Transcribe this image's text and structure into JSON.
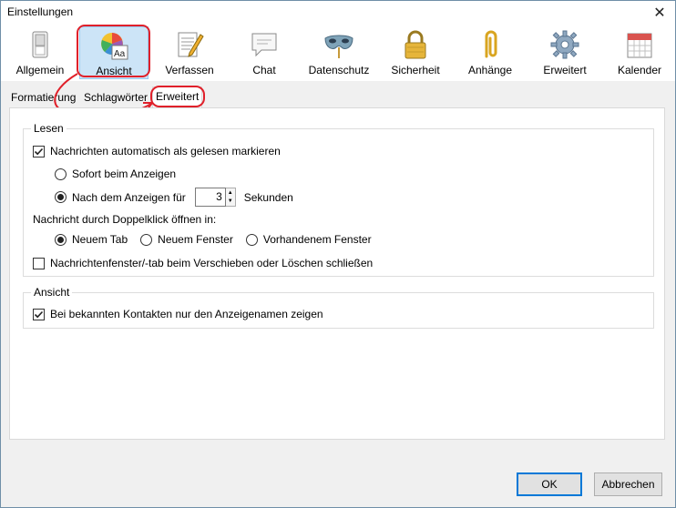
{
  "window": {
    "title": "Einstellungen",
    "close_glyph": "✕"
  },
  "toolbar": {
    "items": [
      {
        "label": "Allgemein",
        "icon": "switch-icon"
      },
      {
        "label": "Ansicht",
        "icon": "palette-icon",
        "selected": true
      },
      {
        "label": "Verfassen",
        "icon": "compose-icon"
      },
      {
        "label": "Chat",
        "icon": "chat-bubble-icon"
      },
      {
        "label": "Datenschutz",
        "icon": "mask-icon"
      },
      {
        "label": "Sicherheit",
        "icon": "lock-icon"
      },
      {
        "label": "Anhänge",
        "icon": "paperclip-icon"
      },
      {
        "label": "Erweitert",
        "icon": "gear-icon"
      },
      {
        "label": "Kalender",
        "icon": "calendar-icon"
      }
    ]
  },
  "subtabs": [
    {
      "label": "Formatierung"
    },
    {
      "label": "Schlagwörter"
    },
    {
      "label": "Erweitert",
      "active": true
    }
  ],
  "lesen": {
    "title": "Lesen",
    "auto_mark_label": "Nachrichten automatisch als gelesen markieren",
    "auto_mark_checked": true,
    "radio_immediate": "Sofort beim Anzeigen",
    "radio_after": "Nach dem Anzeigen für",
    "seconds_value": "3",
    "seconds_unit": "Sekunden",
    "open_label": "Nachricht durch Doppelklick öffnen in:",
    "open_new_tab": "Neuem Tab",
    "open_new_window": "Neuem Fenster",
    "open_existing_window": "Vorhandenem Fenster",
    "close_on_move_label": "Nachrichtenfenster/-tab beim Verschieben oder Löschen schließen",
    "close_on_move_checked": false
  },
  "ansicht": {
    "title": "Ansicht",
    "display_names_label": "Bei bekannten Kontakten nur den Anzeigenamen zeigen",
    "display_names_checked": true
  },
  "buttons": {
    "ok": "OK",
    "cancel": "Abbrechen"
  },
  "colors": {
    "annotation": "#e0202a",
    "selected_bg": "#cce4f7",
    "default_button": "#0078d7"
  }
}
